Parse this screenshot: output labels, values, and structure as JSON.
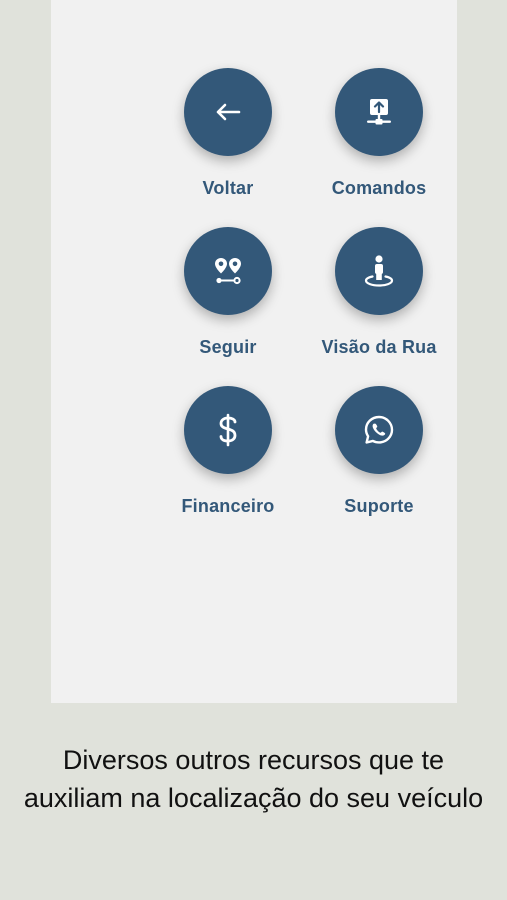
{
  "menu": {
    "items": [
      {
        "label": "Voltar",
        "icon": "arrow-left-icon"
      },
      {
        "label": "Comandos",
        "icon": "upload-server-icon"
      },
      {
        "label": "Seguir",
        "icon": "route-pins-icon"
      },
      {
        "label": "Visão da Rua",
        "icon": "street-view-icon"
      },
      {
        "label": "Financeiro",
        "icon": "dollar-icon"
      },
      {
        "label": "Suporte",
        "icon": "whatsapp-icon"
      }
    ]
  },
  "caption": "Diversos outros recursos que te auxiliam na localização do seu veículo",
  "colors": {
    "accent": "#335879",
    "panel": "#f1f1f1",
    "background": "#e0e2db"
  }
}
